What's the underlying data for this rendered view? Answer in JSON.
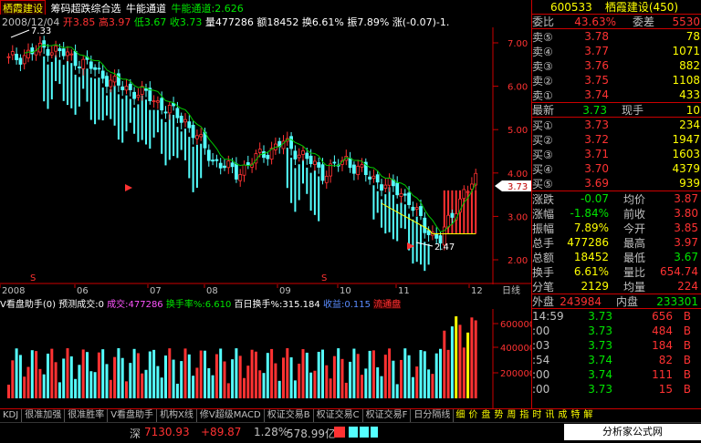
{
  "header": {
    "stock_name": "栖霞建设",
    "indicator_name": "筹码超跌综合选",
    "bull_label": "牛能通道",
    "bull_value_label": "牛能通道:2.626"
  },
  "quote_line": {
    "date": "2008/12/04",
    "open": "开3.85",
    "high": "高3.97",
    "low": "低3.67",
    "close": "收3.73",
    "volume": "量477286",
    "amount": "额18452",
    "turnover": "换6.61%",
    "amplitude": "振7.89%",
    "change": "涨(-0.07)-1."
  },
  "price_axis": {
    "labels": [
      "7.00",
      "6.00",
      "5.00",
      "4.00",
      "3.00",
      "2.00"
    ],
    "current_price": "3.73"
  },
  "annotations": {
    "high_mark": "7.33",
    "low_mark": "2.47",
    "s_marks": [
      "S",
      "S"
    ]
  },
  "time_axis": {
    "labels": [
      "2008",
      "06",
      "07",
      "08",
      "09",
      "10",
      "11",
      "12"
    ],
    "period_label": "日线"
  },
  "volume_panel": {
    "title": "V看盘助手(0)",
    "predict_label": "预测成交:0",
    "volume_label": "成交:477286",
    "turnover_label": "换手率%:6.610",
    "hundred_day_label": "百日换手%:315.184",
    "profit_label": "收益:0.115",
    "flow_label": "流通盘",
    "axis_labels": [
      "600000",
      "400000",
      "200000"
    ]
  },
  "tabs": [
    "KDJ",
    "很准加强",
    "很准胜率",
    "V看盘助手",
    "机构X线",
    "修V超级MACD",
    "权证交易B",
    "权证交易C",
    "权证交易F",
    "日分隔线",
    "细",
    "价",
    "盘",
    "势",
    "周",
    "指",
    "时",
    "讯",
    "成",
    "特",
    "解"
  ],
  "status_bar": {
    "market": "深",
    "index_value": "7130.93",
    "index_change": "+89.87",
    "index_pct": "1.28%",
    "amount": "578.99亿",
    "watermark": "分析家公式网www.88gg.com"
  },
  "right_panel": {
    "code": "600533",
    "name": "栖霞建设",
    "count": "(450)",
    "weibi_label": "委比",
    "weibi_value": "43.63%",
    "weicha_label": "委差",
    "weicha_value": "5530",
    "sells": [
      {
        "label": "卖⑤",
        "price": "3.78",
        "vol": "78"
      },
      {
        "label": "卖④",
        "price": "3.77",
        "vol": "1071"
      },
      {
        "label": "卖③",
        "price": "3.76",
        "vol": "882"
      },
      {
        "label": "卖②",
        "price": "3.75",
        "vol": "1108"
      },
      {
        "label": "卖①",
        "price": "3.74",
        "vol": "433"
      }
    ],
    "latest_label": "最新",
    "latest_value": "3.73",
    "now_hand_label": "现手",
    "now_hand_value": "10",
    "buys": [
      {
        "label": "买①",
        "price": "3.73",
        "vol": "234"
      },
      {
        "label": "买②",
        "price": "3.72",
        "vol": "1947"
      },
      {
        "label": "买③",
        "price": "3.71",
        "vol": "1603"
      },
      {
        "label": "买④",
        "price": "3.70",
        "vol": "4379"
      },
      {
        "label": "买⑤",
        "price": "3.69",
        "vol": "939"
      }
    ],
    "stats": [
      {
        "l1": "涨跌",
        "v1": "-0.07",
        "l2": "均价",
        "v2": "3.87"
      },
      {
        "l1": "涨幅",
        "v1": "-1.84%",
        "l2": "前收",
        "v2": "3.80"
      },
      {
        "l1": "振幅",
        "v1": "7.89%",
        "l2": "今开",
        "v2": "3.85"
      },
      {
        "l1": "总手",
        "v1": "477286",
        "l2": "最高",
        "v2": "3.97"
      },
      {
        "l1": "总额",
        "v1": "18452",
        "l2": "最低",
        "v2": "3.67"
      },
      {
        "l1": "换手",
        "v1": "6.61%",
        "l2": "量比",
        "v2": "654.74"
      },
      {
        "l1": "分笔",
        "v1": "2129",
        "l2": "均量",
        "v2": "224"
      }
    ],
    "outer_label": "外盘",
    "outer_value": "243984",
    "inner_label": "内盘",
    "inner_value": "233301",
    "ticks": [
      {
        "time": "14:59",
        "price": "3.73",
        "vol": "656",
        "side": "B"
      },
      {
        "time": ":00",
        "price": "3.73",
        "vol": "484",
        "side": "B"
      },
      {
        "time": ":03",
        "price": "3.73",
        "vol": "184",
        "side": "B"
      },
      {
        "time": ":54",
        "price": "3.74",
        "vol": "82",
        "side": "B"
      },
      {
        "time": ":00",
        "price": "3.74",
        "vol": "111",
        "side": "B"
      },
      {
        "time": ":00",
        "price": "3.73",
        "vol": "15",
        "side": "B"
      }
    ]
  }
}
